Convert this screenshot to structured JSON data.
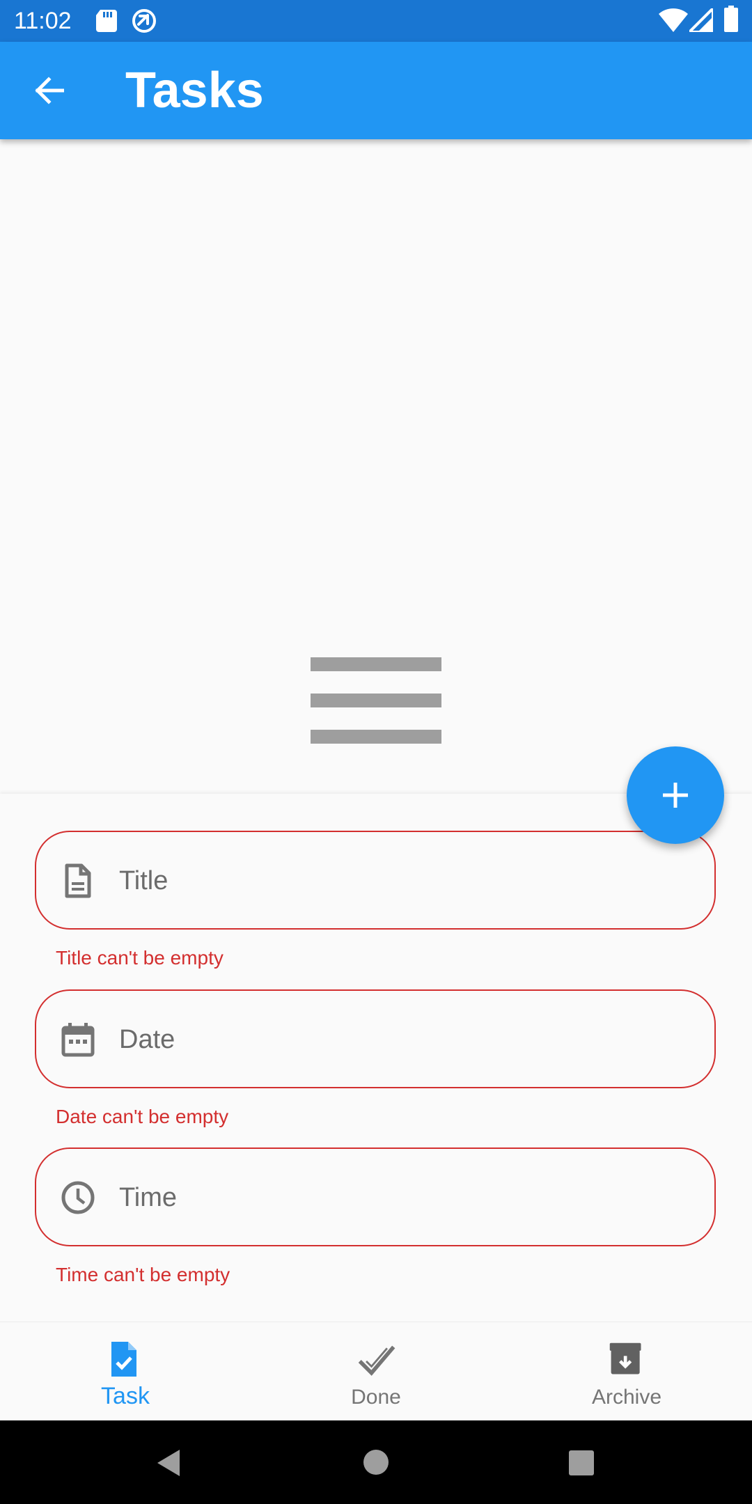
{
  "status_bar": {
    "time": "11:02",
    "left_icons": [
      "sd-card-icon",
      "sync-icon"
    ],
    "right_icons": [
      "wifi-icon",
      "signal-icon",
      "battery-icon"
    ]
  },
  "app_bar": {
    "back_icon": "arrow-back-icon",
    "title": "Tasks"
  },
  "empty_state": {
    "icon": "menu-lines-icon"
  },
  "fab": {
    "icon": "add-icon"
  },
  "form": {
    "fields": [
      {
        "label": "Title",
        "icon": "document-icon",
        "error": "Title can't be empty"
      },
      {
        "label": "Date",
        "icon": "calendar-icon",
        "error": "Date can't be empty"
      },
      {
        "label": "Time",
        "icon": "clock-icon",
        "error": "Time can't be empty"
      }
    ]
  },
  "bottom_nav": {
    "items": [
      {
        "label": "Task",
        "icon": "task-check-icon",
        "selected": true
      },
      {
        "label": "Done",
        "icon": "done-check-icon",
        "selected": false
      },
      {
        "label": "Archive",
        "icon": "archive-icon",
        "selected": false
      }
    ]
  },
  "colors": {
    "primary": "#2196f3",
    "status_bar": "#1976d2",
    "error": "#d32f2f",
    "icon_grey": "#757575",
    "background": "#fafafa"
  }
}
